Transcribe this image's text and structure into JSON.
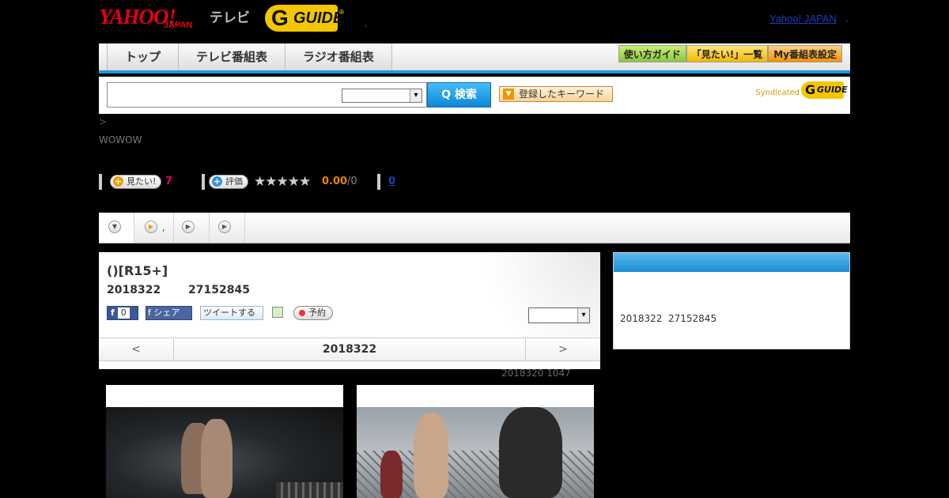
{
  "header": {
    "logo_yahoo": "YAHOO!",
    "logo_japan": "JAPAN",
    "logo_tv": "テレビ",
    "logo_gguide": "GUIDE",
    "logo_reg": "®",
    "dot": ",",
    "yahoo_japan_link": "Yahoo! JAPAN",
    "yahoo_japan_dot": ","
  },
  "nav": {
    "tabs": [
      "トップ",
      "テレビ番組表",
      "ラジオ番組表"
    ],
    "buttons": [
      "使い方ガイド",
      "「見たい!」一覧",
      "My番組表設定"
    ]
  },
  "search": {
    "placeholder": "",
    "select_value": "",
    "button_label": "Q 検索",
    "keyword_button": "登録したキーワード",
    "syndicated": "Syndicated",
    "syndicated_logo": "GUIDE"
  },
  "breadcrumb": {
    "sep": ">"
  },
  "channel": "WOWOW",
  "stats": {
    "want_label": "見たい!",
    "want_count": "7",
    "rate_label": "評価",
    "stars": "★★★★★",
    "score": "0.00",
    "score_den": "/0",
    "link_count": "0"
  },
  "tabstrip": {
    "dot": ","
  },
  "program": {
    "title": "()[R15+]",
    "date": "2018322",
    "time": "27152845",
    "fb_like_label": "f",
    "fb_like_count": "0",
    "fb_share": "f シェア",
    "tweet": "ツイートする",
    "reserve": "予約",
    "select_value": ""
  },
  "daynav": {
    "prev": "<",
    "date": "2018322",
    "next": ">"
  },
  "updated": "2018320  1047",
  "side": {
    "date": "2018322",
    "time": "27152845"
  }
}
